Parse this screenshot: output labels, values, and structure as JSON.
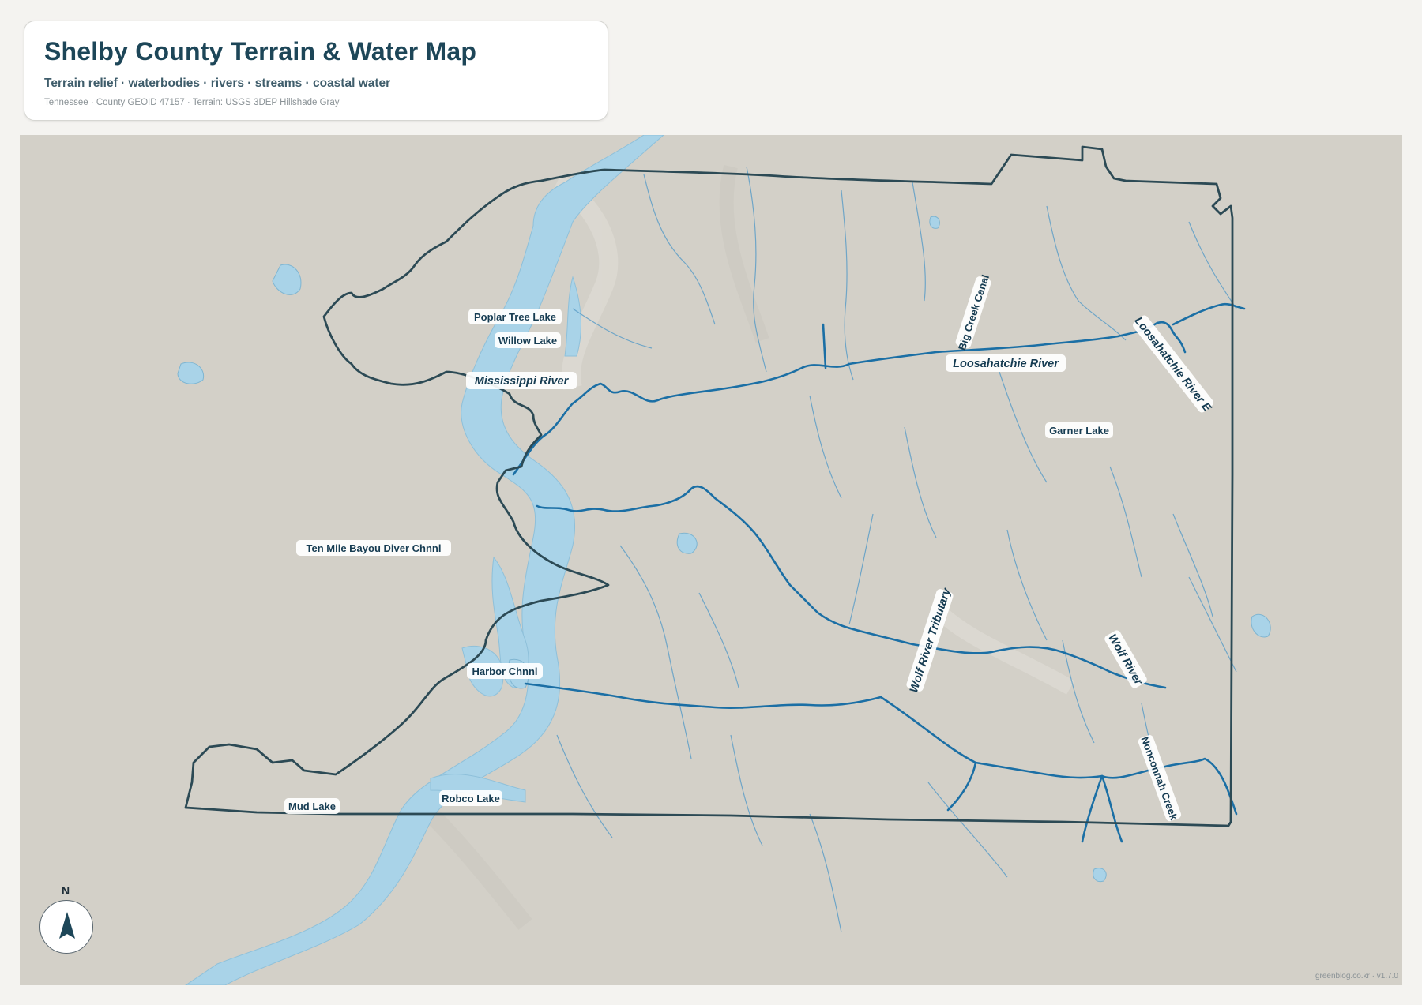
{
  "header": {
    "title": "Shelby County Terrain & Water Map",
    "subtitle": "Terrain relief · waterbodies · rivers · streams · coastal water",
    "source": "Tennessee · County GEOID 47157 · Terrain: USGS 3DEP Hillshade Gray"
  },
  "labels": {
    "poplar_tree_lake": "Poplar Tree Lake",
    "willow_lake": "Willow Lake",
    "mississippi_river": "Mississippi River",
    "big_creek_canal": "Big Creek Canal",
    "loosahatchie_river_e": "Loosahatchie River E",
    "loosahatchie_river": "Loosahatchie River",
    "garner_lake": "Garner Lake",
    "ten_mile_bayou": "Ten Mile Bayou Diver Chnnl",
    "wolf_river_tributary": "Wolf River Tributary",
    "wolf_river": "Wolf River",
    "harbor_chnnl": "Harbor Chnnl",
    "nonconnah_creek": "Nonconnah Creek",
    "mud_lake": "Mud Lake",
    "robco_lake": "Robco Lake"
  },
  "compass": {
    "label": "N"
  },
  "footer": {
    "credit": "greenblog.co.kr · v1.7.0"
  },
  "colors": {
    "background": "#f4f3f0",
    "terrain": "#d3d0c8",
    "water": "#a9d3e8",
    "river": "#1b6fa5",
    "stream": "#5d9ec7",
    "county_boundary": "#2c4a55",
    "title": "#1d4658"
  }
}
